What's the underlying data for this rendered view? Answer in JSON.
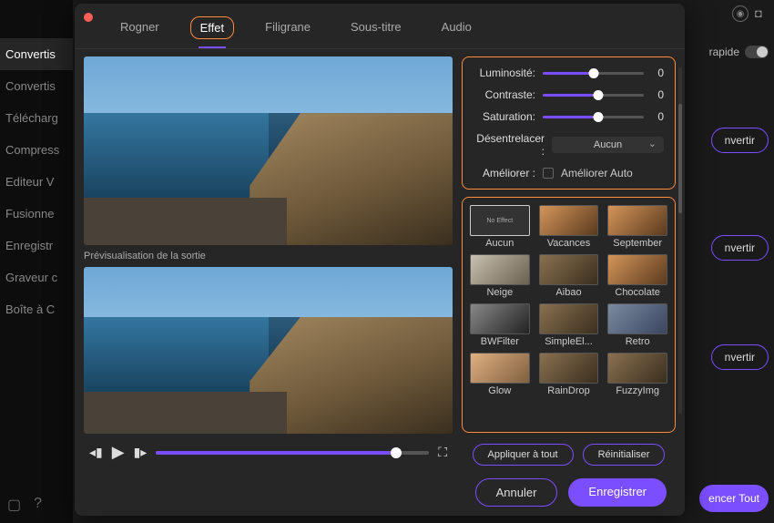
{
  "sidebar": {
    "items": [
      {
        "label": "Convertis"
      },
      {
        "label": "Convertis"
      },
      {
        "label": "Télécharg"
      },
      {
        "label": "Compress"
      },
      {
        "label": "Editeur V"
      },
      {
        "label": "Fusionne"
      },
      {
        "label": "Enregistr"
      },
      {
        "label": "Graveur c"
      },
      {
        "label": "Boîte à C"
      }
    ],
    "bottom_book": "▢",
    "bottom_help": "?"
  },
  "bg": {
    "rapide": "rapide",
    "convert": "nvertir",
    "convert_all": "encer Tout"
  },
  "topbar_icons": {
    "avatar": "◯",
    "chat": "☐"
  },
  "tabs": {
    "rogner": "Rogner",
    "effet": "Effet",
    "filigrane": "Filigrane",
    "soustitre": "Sous-titre",
    "audio": "Audio"
  },
  "preview_label": "Prévisualisation de la sortie",
  "playback": {
    "prev": "◂▮",
    "play": "▶",
    "next": "▮▸",
    "fullscreen": "⛶"
  },
  "adjust": {
    "luminosite": {
      "label": "Luminosité:",
      "value": "0",
      "pct": 50
    },
    "contraste": {
      "label": "Contraste:",
      "value": "0",
      "pct": 55
    },
    "saturation": {
      "label": "Saturation:",
      "value": "0",
      "pct": 55
    },
    "deinterlace_label": "Désentrelacer :",
    "deinterlace_value": "Aucun",
    "enhance_label": "Améliorer :",
    "enhance_auto": "Améliorer Auto"
  },
  "effects": [
    {
      "name": "Aucun",
      "cls": "thumb-none",
      "text": "No Effect",
      "selected": true
    },
    {
      "name": "Vacances",
      "cls": "thumb-warm"
    },
    {
      "name": "September",
      "cls": "thumb-warm"
    },
    {
      "name": "Neige",
      "cls": "thumb-snow"
    },
    {
      "name": "Aibao",
      "cls": "thumb-img"
    },
    {
      "name": "Chocolate",
      "cls": "thumb-warm"
    },
    {
      "name": "BWFilter",
      "cls": "thumb-bw"
    },
    {
      "name": "SimpleEl...",
      "cls": "thumb-img"
    },
    {
      "name": "Retro",
      "cls": "thumb-cool"
    },
    {
      "name": "Glow",
      "cls": "thumb-glow"
    },
    {
      "name": "RainDrop",
      "cls": "thumb-img"
    },
    {
      "name": "FuzzyImg",
      "cls": "thumb-img"
    }
  ],
  "buttons": {
    "apply_all": "Appliquer à tout",
    "reset": "Réinitialiser",
    "cancel": "Annuler",
    "save": "Enregistrer"
  }
}
